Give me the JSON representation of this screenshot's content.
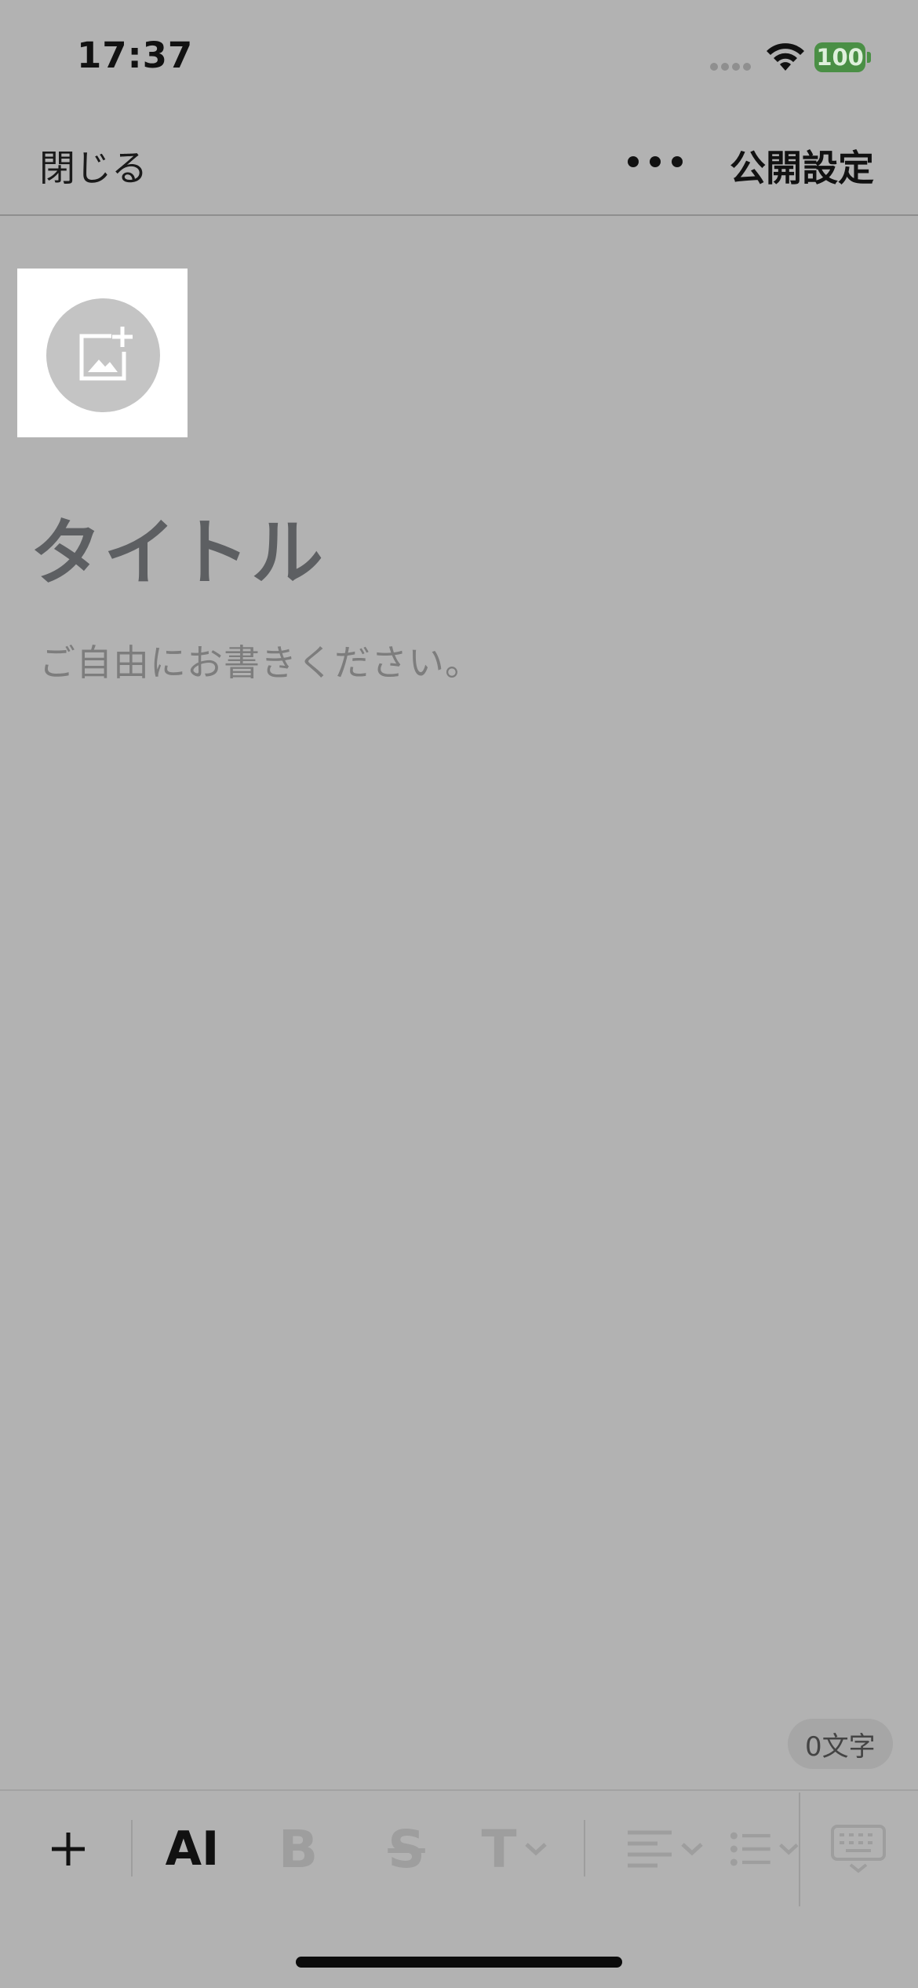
{
  "status_bar": {
    "time": "17:37",
    "battery_level": "100",
    "battery_color": "#4a8f45"
  },
  "nav": {
    "close_label": "閉じる",
    "more_icon": "more-horizontal-icon",
    "publish_label": "公開設定"
  },
  "editor": {
    "header_image_icon": "add-image-icon",
    "title_placeholder": "タイトル",
    "body_placeholder": "ご自由にお書きください。",
    "char_count": "0文字"
  },
  "toolbar": {
    "insert_icon": "plus-icon",
    "ai_label": "AI",
    "bold_label": "B",
    "strike_label": "S",
    "text_style_label": "T",
    "align_icon": "align-left-icon",
    "list_icon": "list-icon",
    "keyboard_icon": "keyboard-icon"
  },
  "colors": {
    "background": "#b2b2b2",
    "disabled": "#9e9e9e",
    "title": "#5d5f62"
  }
}
